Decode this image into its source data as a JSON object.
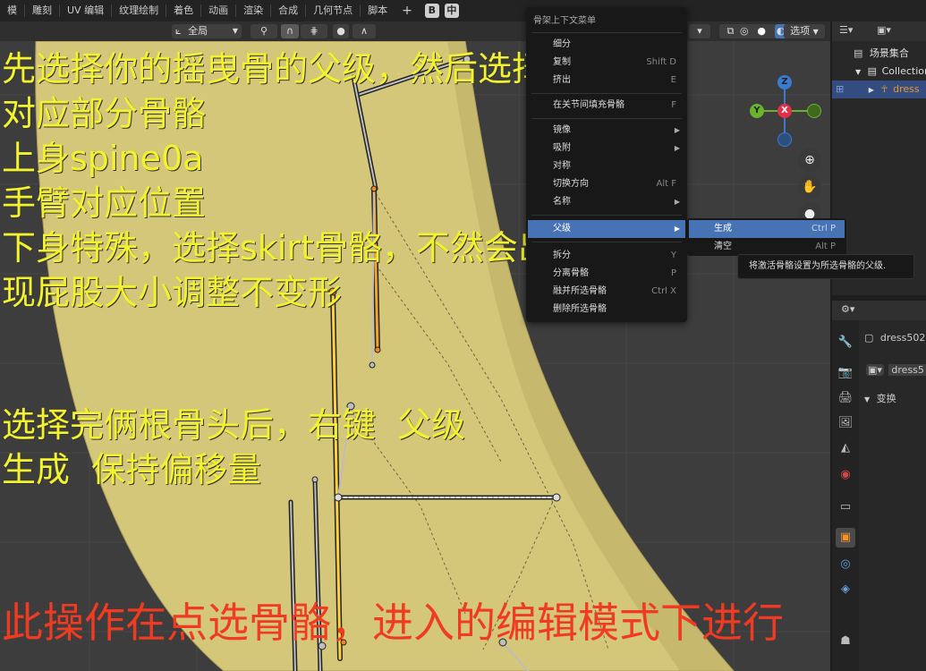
{
  "topbar": {
    "tabs": [
      "模",
      "雕刻",
      "UV 编辑",
      "纹理绘制",
      "着色",
      "动画",
      "渲染",
      "合成",
      "几何节点",
      "脚本"
    ],
    "add_label": "+",
    "lang_label": "中"
  },
  "viewport_header": {
    "pivot": "全局",
    "view_menu": "选项",
    "x_toggle": "X"
  },
  "annotations": {
    "yellow_block_1": "先选择你的摇曳骨的父级，然后选择\n对应部分骨骼\n上身spine0a\n手臂对应位置\n下身特殊，选择skirt骨骼，不然会出\n现屁股大小调整不变形",
    "yellow_block_2": "选择完俩根骨头后，右键  父级\n生成  保持偏移量",
    "red_note": "此操作在点选骨骼，进入的编辑模式下进行"
  },
  "gizmo": {
    "z": "Z",
    "y": "Y",
    "x": "X"
  },
  "context_menu": {
    "title": "骨架上下文菜单",
    "items": [
      {
        "label": "细分",
        "shortcut": ""
      },
      {
        "label": "复制",
        "shortcut": "Shift D"
      },
      {
        "label": "挤出",
        "shortcut": "E"
      },
      {
        "label": "在关节间填充骨骼",
        "shortcut": "F"
      },
      {
        "label": "镜像",
        "shortcut": ""
      },
      {
        "label": "吸附",
        "shortcut": ""
      },
      {
        "label": "对称",
        "shortcut": ""
      },
      {
        "label": "切换方向",
        "shortcut": "Alt F"
      },
      {
        "label": "名称",
        "shortcut": ""
      },
      {
        "label": "父级",
        "shortcut": ""
      },
      {
        "label": "拆分",
        "shortcut": "Y"
      },
      {
        "label": "分离骨骼",
        "shortcut": "P"
      },
      {
        "label": "融并所选骨骼",
        "shortcut": "Ctrl X"
      },
      {
        "label": "删除所选骨骼",
        "shortcut": ""
      }
    ]
  },
  "submenu": {
    "items": [
      {
        "label": "生成",
        "shortcut": "Ctrl P"
      },
      {
        "label": "清空",
        "shortcut": "Alt P"
      }
    ]
  },
  "tooltip": "将激活骨骼设置为所选骨骼的父级.",
  "outliner": {
    "scene_collection": "场景集合",
    "collection": "Collection",
    "object": "dress"
  },
  "properties": {
    "object_name": "dress502",
    "data_name": "dress5",
    "section": "变换"
  },
  "colors": {
    "menu_highlight": "#4772b3",
    "annotation_yellow": "#f2f22e",
    "annotation_red": "#f03a22",
    "mesh": "#d4c77a"
  }
}
